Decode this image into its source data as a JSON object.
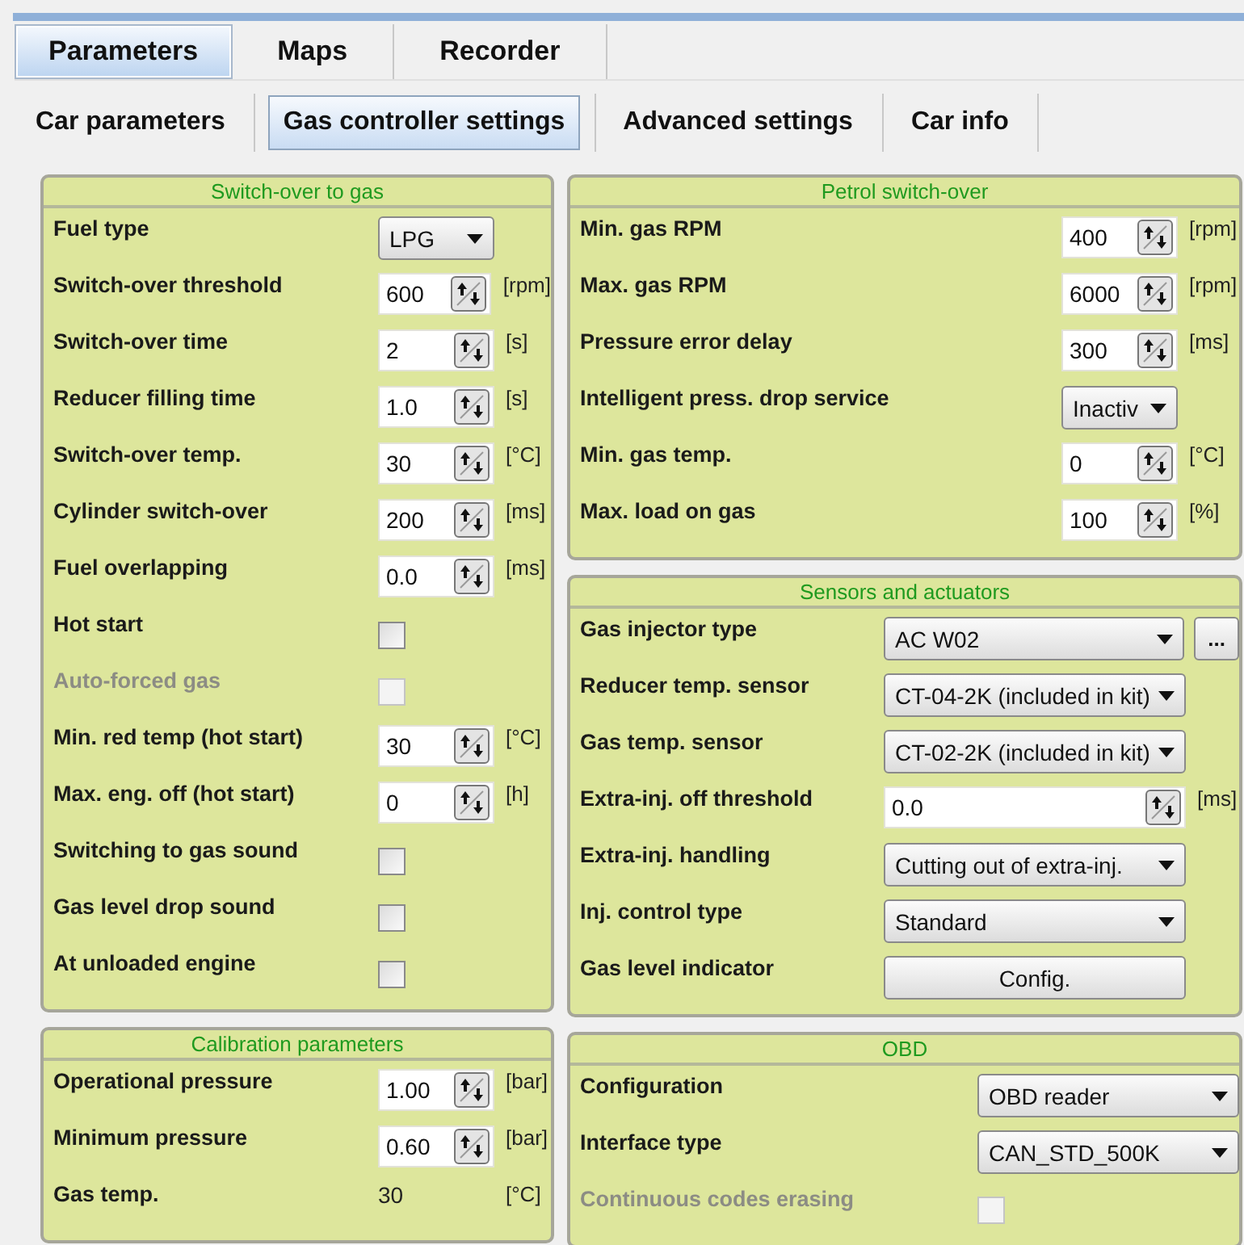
{
  "tabs": [
    {
      "label": "Parameters",
      "selected": true
    },
    {
      "label": "Maps",
      "selected": false
    },
    {
      "label": "Recorder",
      "selected": false
    }
  ],
  "subtabs": [
    {
      "label": "Car parameters",
      "selected": false
    },
    {
      "label": "Gas controller settings",
      "selected": true
    },
    {
      "label": "Advanced settings",
      "selected": false
    },
    {
      "label": "Car info",
      "selected": false
    }
  ],
  "left_panels": [
    {
      "title": "Switch-over to gas",
      "rows": [
        {
          "label": "Fuel type",
          "kind": "select",
          "value": "LPG",
          "disabled": false
        },
        {
          "label": "Switch-over threshold",
          "kind": "spin",
          "value": "600",
          "unit": "[rpm]",
          "disabled": false
        },
        {
          "label": "Switch-over time",
          "kind": "spin",
          "value": "2",
          "unit": "[s]",
          "disabled": false
        },
        {
          "label": "Reducer filling time",
          "kind": "spin",
          "value": "1.0",
          "unit": "[s]",
          "disabled": false
        },
        {
          "label": "Switch-over temp.",
          "kind": "spin",
          "value": "30",
          "unit": "[°C]",
          "disabled": false
        },
        {
          "label": "Cylinder switch-over",
          "kind": "spin",
          "value": "200",
          "unit": "[ms]",
          "disabled": false
        },
        {
          "label": "Fuel overlapping",
          "kind": "spin",
          "value": "0.0",
          "unit": "[ms]",
          "disabled": false
        },
        {
          "label": "Hot start",
          "kind": "check",
          "checked": false,
          "disabled": false
        },
        {
          "label": "Auto-forced gas",
          "kind": "check",
          "checked": false,
          "disabled": true
        },
        {
          "label": "Min. red temp (hot start)",
          "kind": "spin",
          "value": "30",
          "unit": "[°C]",
          "disabled": false
        },
        {
          "label": "Max. eng. off (hot start)",
          "kind": "spin",
          "value": "0",
          "unit": "[h]",
          "disabled": false
        },
        {
          "label": "Switching to gas sound",
          "kind": "check",
          "checked": false,
          "disabled": false
        },
        {
          "label": "Gas level drop sound",
          "kind": "check",
          "checked": false,
          "disabled": false
        },
        {
          "label": "At unloaded engine",
          "kind": "check",
          "checked": false,
          "disabled": false
        }
      ]
    },
    {
      "title": "Calibration parameters",
      "rows": [
        {
          "label": "Operational pressure",
          "kind": "spin",
          "value": "1.00",
          "unit": "[bar]",
          "disabled": false
        },
        {
          "label": "Minimum pressure",
          "kind": "spin",
          "value": "0.60",
          "unit": "[bar]",
          "disabled": false
        },
        {
          "label": "Gas temp.",
          "kind": "text",
          "value": "30",
          "unit": "[°C]",
          "disabled": false
        }
      ]
    }
  ],
  "right_panels": [
    {
      "title": "Petrol switch-over",
      "rows": [
        {
          "label": "Min. gas RPM",
          "kind": "spin",
          "value": "400",
          "unit": "[rpm]",
          "disabled": false
        },
        {
          "label": "Max. gas RPM",
          "kind": "spin",
          "value": "6000",
          "unit": "[rpm]",
          "disabled": false
        },
        {
          "label": "Pressure error delay",
          "kind": "spin",
          "value": "300",
          "unit": "[ms]",
          "disabled": false
        },
        {
          "label": "Intelligent press. drop service",
          "kind": "select",
          "value": "Inactiv",
          "disabled": false
        },
        {
          "label": "Min. gas temp.",
          "kind": "spin",
          "value": "0",
          "unit": "[°C]",
          "disabled": false
        },
        {
          "label": "Max. load on gas",
          "kind": "spin",
          "value": "100",
          "unit": "[%]",
          "disabled": false
        }
      ]
    },
    {
      "title": "Sensors and actuators",
      "rows": [
        {
          "label": "Gas injector type",
          "kind": "select",
          "value": "AC W02",
          "more_button": "...",
          "disabled": false
        },
        {
          "label": "Reducer temp. sensor",
          "kind": "select",
          "value": "CT-04-2K (included in kit)",
          "disabled": false
        },
        {
          "label": "Gas temp. sensor",
          "kind": "select",
          "value": "CT-02-2K (included in kit)",
          "disabled": false
        },
        {
          "label": "Extra-inj. off threshold",
          "kind": "spin",
          "value": "0.0",
          "unit": "[ms]",
          "disabled": false
        },
        {
          "label": "Extra-inj. handling",
          "kind": "select",
          "value": "Cutting out of extra-inj.",
          "disabled": false
        },
        {
          "label": "Inj. control type",
          "kind": "select",
          "value": "Standard",
          "disabled": false
        },
        {
          "label": "Gas level indicator",
          "kind": "button",
          "value": "Config.",
          "disabled": false
        }
      ]
    },
    {
      "title": "OBD",
      "rows": [
        {
          "label": "Configuration",
          "kind": "select",
          "value": "OBD reader",
          "disabled": false
        },
        {
          "label": "Interface type",
          "kind": "select",
          "value": "CAN_STD_500K",
          "disabled": false
        },
        {
          "label": "Continuous codes erasing",
          "kind": "check",
          "checked": false,
          "disabled": true
        }
      ]
    }
  ]
}
